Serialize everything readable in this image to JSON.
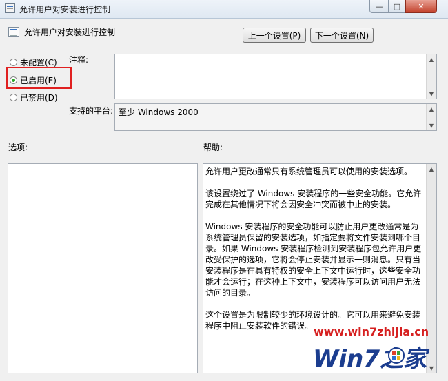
{
  "window": {
    "title": "允许用户对安装进行控制"
  },
  "caption_buttons": {
    "minimize": "—",
    "maximize": "□",
    "close": "✕"
  },
  "header": {
    "title": "允许用户对安装进行控制",
    "prev_label": "上一个设置(P)",
    "next_label": "下一个设置(N)"
  },
  "state": {
    "options": [
      {
        "label": "未配置(C)",
        "selected": false
      },
      {
        "label": "已启用(E)",
        "selected": true
      },
      {
        "label": "已禁用(D)",
        "selected": false
      }
    ]
  },
  "labels": {
    "note": "注释:",
    "platform": "支持的平台:",
    "options": "选项:",
    "help": "帮助:"
  },
  "note": {
    "value": ""
  },
  "platform": {
    "value": "至少 Windows 2000"
  },
  "help": {
    "paragraphs": [
      "允许用户更改通常只有系统管理员可以使用的安装选项。",
      "该设置绕过了 Windows 安装程序的一些安全功能。它允许完成在其他情况下将会因安全冲突而被中止的安装。",
      "Windows 安装程序的安全功能可以防止用户更改通常是为系统管理员保留的安装选项，如指定要将文件安装到哪个目录。如果 Windows 安装程序检测到安装程序包允许用户更改受保护的选项，它将会停止安装并显示一则消息。只有当安装程序是在具有特权的安全上下文中运行时，这些安全功能才会运行；在这种上下文中，安装程序可以访问用户无法访问的目录。",
      "这个设置是为限制较少的环境设计的。它可以用来避免安装程序中阻止安装软件的错误。"
    ]
  },
  "watermark": {
    "url": "www.win7zhijia.cn",
    "logo_text": "Win7之家"
  },
  "colors": {
    "highlight": "#e02020",
    "radio_on": "#2aa52a"
  }
}
